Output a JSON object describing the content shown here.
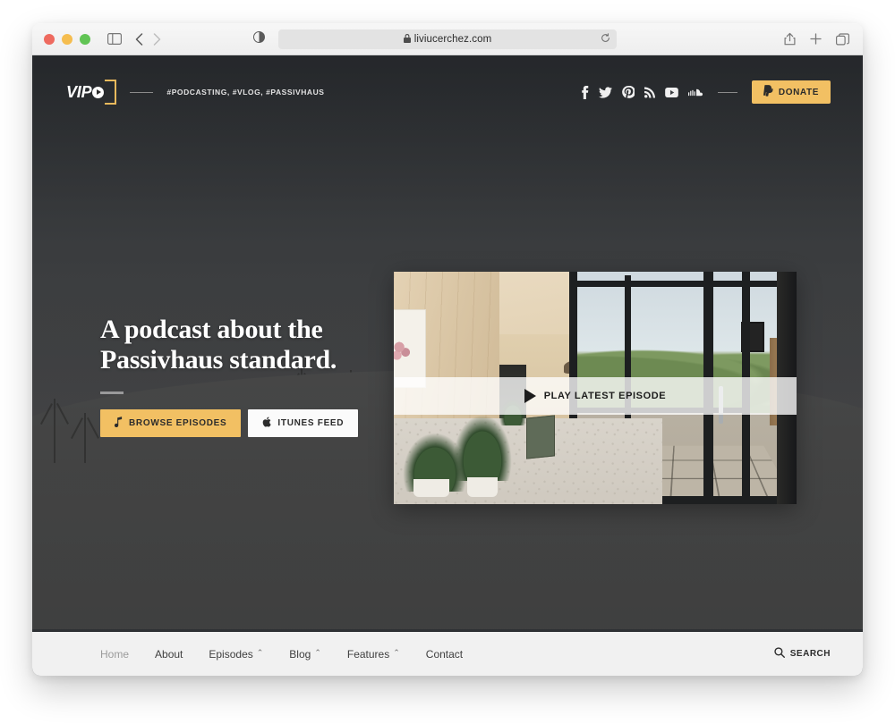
{
  "browser": {
    "url": "liviucerchez.com",
    "lock_icon": "lock-icon",
    "reload_icon": "reload-icon",
    "reader_icon": "reader-view-icon",
    "sidebar_icon": "sidebar-toggle-icon",
    "back_icon": "back-arrow-icon",
    "forward_icon": "forward-arrow-icon",
    "share_icon": "share-icon",
    "newtab_icon": "plus-icon",
    "tabs_icon": "tab-overview-icon",
    "traffic": {
      "close": "close-window-button",
      "minimize": "minimize-window-button",
      "zoom": "zoom-window-button"
    }
  },
  "header": {
    "logo_text": "VIP",
    "logo_play_icon": "play-circle-icon",
    "tagline": "#PODCASTING, #VLOG, #PASSIVHAUS",
    "socials": [
      {
        "name": "facebook-icon",
        "label": "Facebook"
      },
      {
        "name": "twitter-icon",
        "label": "Twitter"
      },
      {
        "name": "pinterest-icon",
        "label": "Pinterest"
      },
      {
        "name": "rss-icon",
        "label": "RSS"
      },
      {
        "name": "youtube-icon",
        "label": "YouTube"
      },
      {
        "name": "soundcloud-icon",
        "label": "SoundCloud"
      }
    ],
    "donate_label": "DONATE",
    "donate_icon": "paypal-icon"
  },
  "hero": {
    "headline_line1": "A podcast about the",
    "headline_line2": "Passivhaus standard.",
    "browse_label": "BROWSE EPISODES",
    "browse_icon": "music-note-icon",
    "itunes_label": "ITUNES FEED",
    "itunes_icon": "apple-icon",
    "play_label": "PLAY LATEST EPISODE",
    "play_icon": "play-triangle-icon"
  },
  "footer": {
    "nav": [
      {
        "label": "Home",
        "has_chevron": false,
        "active": true
      },
      {
        "label": "About",
        "has_chevron": false,
        "active": false
      },
      {
        "label": "Episodes",
        "has_chevron": true,
        "active": false
      },
      {
        "label": "Blog",
        "has_chevron": true,
        "active": false
      },
      {
        "label": "Features",
        "has_chevron": true,
        "active": false
      },
      {
        "label": "Contact",
        "has_chevron": false,
        "active": false
      }
    ],
    "chevron": "⌃",
    "search_label": "SEARCH",
    "search_icon": "search-icon"
  },
  "colors": {
    "accent_gold": "#f2c063",
    "hero_dark": "#3b3e41",
    "footer_bg": "#f1f1f1"
  }
}
